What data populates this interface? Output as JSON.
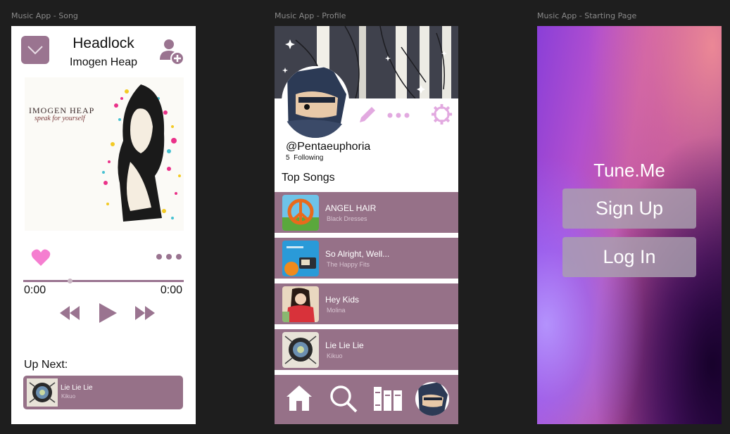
{
  "frames": {
    "song_label": "Music App - Song",
    "profile_label": "Music App - Profile",
    "start_label": "Music App - Starting Page"
  },
  "colors": {
    "accent": "#967188",
    "heart": "#f57ed0",
    "icon_light": "#e2a9e0",
    "background": "#1e1e1e"
  },
  "song": {
    "title": "Headlock",
    "artist": "Imogen Heap",
    "album_text_line1": "IMOGEN HEAP",
    "album_text_line2": "speak for yourself",
    "progress": 0.29,
    "time_elapsed": "0:00",
    "time_total": "0:00",
    "up_next_label": "Up Next:",
    "up_next": {
      "title": "Lie Lie Lie",
      "artist": "Kikuo"
    },
    "icons": [
      "mail-icon",
      "add-user-icon",
      "heart-icon",
      "more-icon",
      "rewind-icon",
      "play-icon",
      "fast-forward-icon"
    ]
  },
  "profile": {
    "username": "@Pentaeuphoria",
    "following_count": "5",
    "following_label": "Following",
    "top_songs_title": "Top Songs",
    "top_songs": [
      {
        "title": "ANGEL HAIR",
        "artist": "Black Dresses"
      },
      {
        "title": "So Alright, Well...",
        "artist": "The Happy Fits"
      },
      {
        "title": "Hey Kids",
        "artist": "Molina"
      },
      {
        "title": "Lie Lie Lie",
        "artist": "Kikuo"
      }
    ],
    "nav": [
      "home-icon",
      "search-icon",
      "library-icon",
      "profile-avatar"
    ]
  },
  "start": {
    "app_name": "Tune.Me",
    "sign_up": "Sign Up",
    "log_in": "Log In"
  }
}
